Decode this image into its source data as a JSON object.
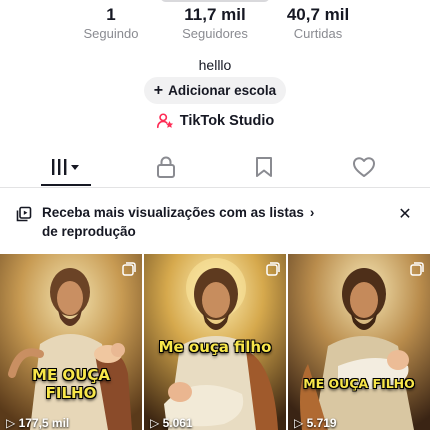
{
  "profile": {
    "stats": [
      {
        "value": "1",
        "label": "Seguindo"
      },
      {
        "value": "11,7 mil",
        "label": "Seguidores"
      },
      {
        "value": "40,7 mil",
        "label": "Curtidas"
      }
    ],
    "bio": "helllo",
    "add_school_label": "Adicionar escola",
    "studio_label": "TikTok Studio"
  },
  "tabs": [
    {
      "name": "videos-grid",
      "icon": "grid-bars-icon",
      "active": true
    },
    {
      "name": "private",
      "icon": "lock-icon",
      "active": false
    },
    {
      "name": "favorites",
      "icon": "bookmark-icon",
      "active": false
    },
    {
      "name": "liked",
      "icon": "heart-icon",
      "active": false
    }
  ],
  "banner": {
    "text_line1": "Receba mais visualizações com as listas",
    "text_line2": "de reprodução",
    "icon": "playlist-icon",
    "close_icon": "close-icon"
  },
  "videos": [
    {
      "overlay_line1": "ME OUÇA",
      "overlay_line2": "FILHO",
      "views": "177,5 mil",
      "icon": "multi-image-icon"
    },
    {
      "overlay_line1": "Me ouça filho",
      "overlay_line2": "",
      "views": "5.061",
      "icon": "multi-image-icon"
    },
    {
      "overlay_line1": "ME OUÇA FILHO",
      "overlay_line2": "",
      "views": "5.719",
      "icon": "multi-image-icon"
    }
  ],
  "colors": {
    "text_primary": "#161823",
    "text_secondary": "#8a8b91",
    "button_bg": "#f1f1f2",
    "studio_accent": "#fe2c55",
    "overlay_yellow": "#f7e64a"
  }
}
